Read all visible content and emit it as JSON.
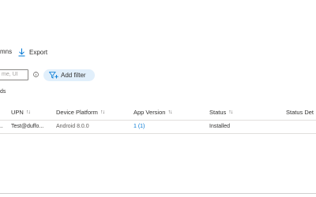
{
  "toolbar": {
    "columns_label": "mns",
    "export_label": "Export"
  },
  "filter": {
    "search_placeholder": "me, UI",
    "add_filter_label": "Add filter"
  },
  "records_label": "ds",
  "table": {
    "columns": [
      {
        "label": "UPN",
        "sortable": true
      },
      {
        "label": "Device Platform",
        "sortable": true
      },
      {
        "label": "App Version",
        "sortable": true
      },
      {
        "label": "Status",
        "sortable": true
      },
      {
        "label": "Status Det",
        "sortable": false
      }
    ],
    "sort_icon": "↑↓",
    "rows": [
      {
        "lead": "...",
        "upn": "Test@duffo...",
        "platform": "Android 8.0.0",
        "app_version": "1 (1)",
        "status": "Installed",
        "status_details": ""
      }
    ]
  },
  "colors": {
    "accent": "#0078d4",
    "filter_pill_bg": "#e1effb",
    "border": "#e1dfdd"
  },
  "icons": {
    "export": "download-icon",
    "info": "info-icon",
    "add_filter": "add-filter-icon"
  }
}
